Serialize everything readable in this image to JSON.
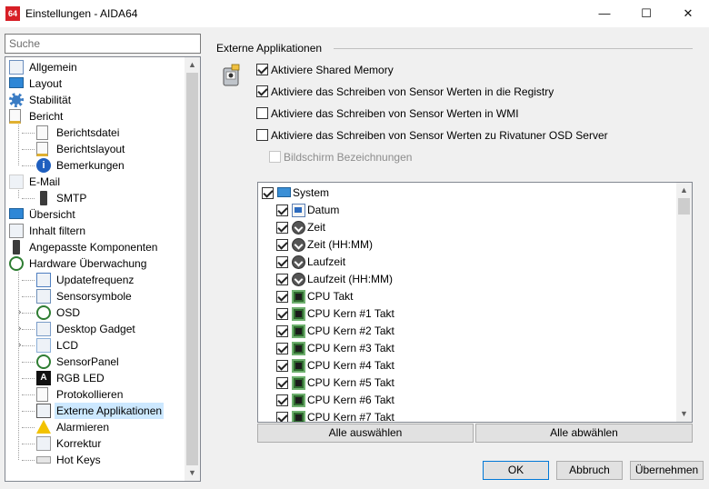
{
  "window": {
    "title": "Einstellungen - AIDA64",
    "app_icon_text": "64",
    "minimize": "—",
    "maximize": "☐",
    "close": "✕"
  },
  "search": {
    "placeholder": "Suche"
  },
  "sidebar": {
    "items": [
      {
        "label": "Allgemein",
        "icon": "settings-list-icon"
      },
      {
        "label": "Layout",
        "icon": "monitor-icon"
      },
      {
        "label": "Stabilität",
        "icon": "gear-icon"
      },
      {
        "label": "Bericht",
        "icon": "report-icon"
      },
      {
        "label": "Berichtsdatei",
        "icon": "document-icon"
      },
      {
        "label": "Berichtslayout",
        "icon": "document-edit-icon"
      },
      {
        "label": "Bemerkungen",
        "icon": "info-icon"
      },
      {
        "label": "E-Mail",
        "icon": "mail-icon"
      },
      {
        "label": "SMTP",
        "icon": "phone-icon"
      },
      {
        "label": "Übersicht",
        "icon": "monitor-icon"
      },
      {
        "label": "Inhalt filtern",
        "icon": "filter-icon"
      },
      {
        "label": "Angepasste Komponenten",
        "icon": "device-icon"
      },
      {
        "label": "Hardware Überwachung",
        "icon": "gauge-icon"
      },
      {
        "label": "Updatefrequenz",
        "icon": "refresh-icon"
      },
      {
        "label": "Sensorsymbole",
        "icon": "sensor-icon"
      },
      {
        "label": "OSD",
        "icon": "gauge-icon"
      },
      {
        "label": "Desktop Gadget",
        "icon": "gadget-icon"
      },
      {
        "label": "LCD",
        "icon": "lcd-icon"
      },
      {
        "label": "SensorPanel",
        "icon": "gauge-icon"
      },
      {
        "label": "RGB LED",
        "icon": "rgb-icon"
      },
      {
        "label": "Protokollieren",
        "icon": "document-icon"
      },
      {
        "label": "Externe Applikationen",
        "icon": "external-app-icon"
      },
      {
        "label": "Alarmieren",
        "icon": "warning-icon"
      },
      {
        "label": "Korrektur",
        "icon": "correction-icon"
      },
      {
        "label": "Hot Keys",
        "icon": "keyboard-icon"
      }
    ],
    "selected": "Externe Applikationen"
  },
  "section": {
    "title": "Externe Applikationen"
  },
  "options": [
    {
      "label": "Aktiviere Shared Memory",
      "checked": true,
      "enabled": true
    },
    {
      "label": "Aktiviere das Schreiben von Sensor Werten in die Registry",
      "checked": true,
      "enabled": true
    },
    {
      "label": "Aktiviere das Schreiben von Sensor Werten in WMI",
      "checked": false,
      "enabled": true
    },
    {
      "label": "Aktiviere das Schreiben von Sensor Werten zu Rivatuner OSD Server",
      "checked": false,
      "enabled": true
    },
    {
      "label": "Bildschirm Bezeichnungen",
      "checked": false,
      "enabled": false
    }
  ],
  "sensor_list": {
    "items": [
      {
        "label": "System",
        "checked": true,
        "icon": "monitor-icon",
        "level": 0
      },
      {
        "label": "Datum",
        "checked": true,
        "icon": "calendar-icon",
        "level": 1
      },
      {
        "label": "Zeit",
        "checked": true,
        "icon": "clock-icon",
        "level": 1
      },
      {
        "label": "Zeit (HH:MM)",
        "checked": true,
        "icon": "clock-icon",
        "level": 1
      },
      {
        "label": "Laufzeit",
        "checked": true,
        "icon": "clock-icon",
        "level": 1
      },
      {
        "label": "Laufzeit (HH:MM)",
        "checked": true,
        "icon": "clock-icon",
        "level": 1
      },
      {
        "label": "CPU Takt",
        "checked": true,
        "icon": "cpu-icon",
        "level": 1
      },
      {
        "label": "CPU Kern #1 Takt",
        "checked": true,
        "icon": "cpu-icon",
        "level": 1
      },
      {
        "label": "CPU Kern #2 Takt",
        "checked": true,
        "icon": "cpu-icon",
        "level": 1
      },
      {
        "label": "CPU Kern #3 Takt",
        "checked": true,
        "icon": "cpu-icon",
        "level": 1
      },
      {
        "label": "CPU Kern #4 Takt",
        "checked": true,
        "icon": "cpu-icon",
        "level": 1
      },
      {
        "label": "CPU Kern #5 Takt",
        "checked": true,
        "icon": "cpu-icon",
        "level": 1
      },
      {
        "label": "CPU Kern #6 Takt",
        "checked": true,
        "icon": "cpu-icon",
        "level": 1
      },
      {
        "label": "CPU Kern #7 Takt",
        "checked": true,
        "icon": "cpu-icon",
        "level": 1
      }
    ],
    "select_all": "Alle auswählen",
    "deselect_all": "Alle abwählen"
  },
  "footer": {
    "ok": "OK",
    "cancel": "Abbruch",
    "apply": "Übernehmen"
  },
  "colors": {
    "selection": "#cce8ff",
    "accent": "#0078d7",
    "app_red": "#d71f26"
  }
}
